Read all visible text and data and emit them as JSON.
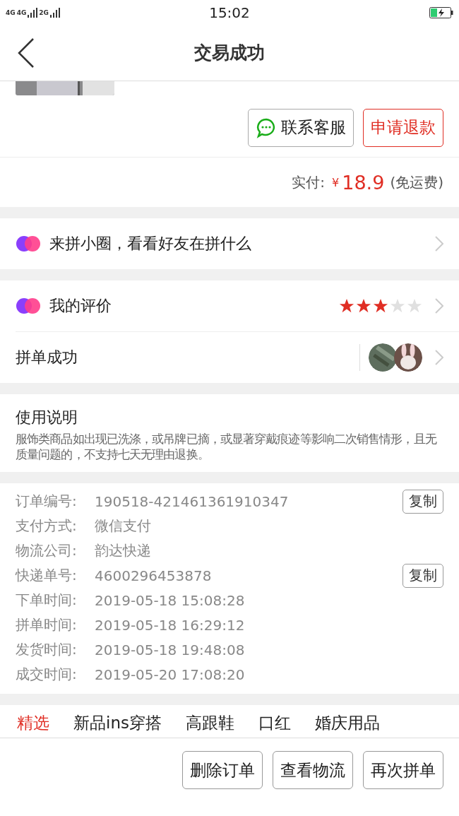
{
  "status_bar": {
    "network_1": "4G",
    "network_2": "4G",
    "network_3": "2G",
    "time": "15:02"
  },
  "header": {
    "title": "交易成功"
  },
  "order_actions": [
    {
      "label": "联系客服",
      "kind": "chat"
    },
    {
      "label": "申请退款",
      "kind": "refund"
    }
  ],
  "payment": {
    "label": "实付:",
    "currency": "¥",
    "amount": "18.9",
    "note": "(免运费)"
  },
  "circle": {
    "label": "来拼小圈，看看好友在拼什么"
  },
  "review": {
    "label": "我的评价",
    "stars": 3
  },
  "group": {
    "label": "拼单成功"
  },
  "usage": {
    "title": "使用说明",
    "text": "服饰类商品如出现已洗涤，或吊牌已摘，或显著穿戴痕迹等影响二次销售情形，且无质量问题的，不支持七天无理由退换。"
  },
  "order_info": [
    {
      "label": "订单编号:",
      "value": "190518-421461361910347",
      "copy": "复制"
    },
    {
      "label": "支付方式:",
      "value": "微信支付"
    },
    {
      "label": "物流公司:",
      "value": "韵达快递"
    },
    {
      "label": "快递单号:",
      "value": "4600296453878",
      "copy": "复制"
    },
    {
      "label": "下单时间:",
      "value": "2019-05-18 15:08:28"
    },
    {
      "label": "拼单时间:",
      "value": "2019-05-18 16:29:12"
    },
    {
      "label": "发货时间:",
      "value": "2019-05-18 19:48:08"
    },
    {
      "label": "成交时间:",
      "value": "2019-05-20 17:08:20"
    }
  ],
  "category_tabs": [
    {
      "label": "精选",
      "selected": true
    },
    {
      "label": "新品ins穿搭",
      "selected": false
    },
    {
      "label": "高跟鞋",
      "selected": false
    },
    {
      "label": "口红",
      "selected": false
    },
    {
      "label": "婚庆用品",
      "selected": false
    }
  ],
  "bottom_buttons": [
    "删除订单",
    "查看物流",
    "再次拼单"
  ]
}
